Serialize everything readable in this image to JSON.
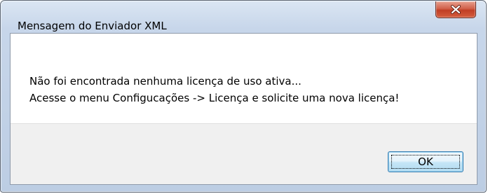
{
  "window": {
    "title": "Mensagem do Enviador XML"
  },
  "titlebar": {
    "close_icon": "close-icon",
    "close_color": "#c7432a"
  },
  "message": {
    "line_1": "Não foi encontrada nenhuma licença de uso ativa...",
    "line_2": "Acesse o menu Configucações -> Licença e solicite uma nova licença!"
  },
  "buttons": {
    "ok_label": "OK",
    "ok_focused": true,
    "ok_accent": "#3c7fb1"
  }
}
